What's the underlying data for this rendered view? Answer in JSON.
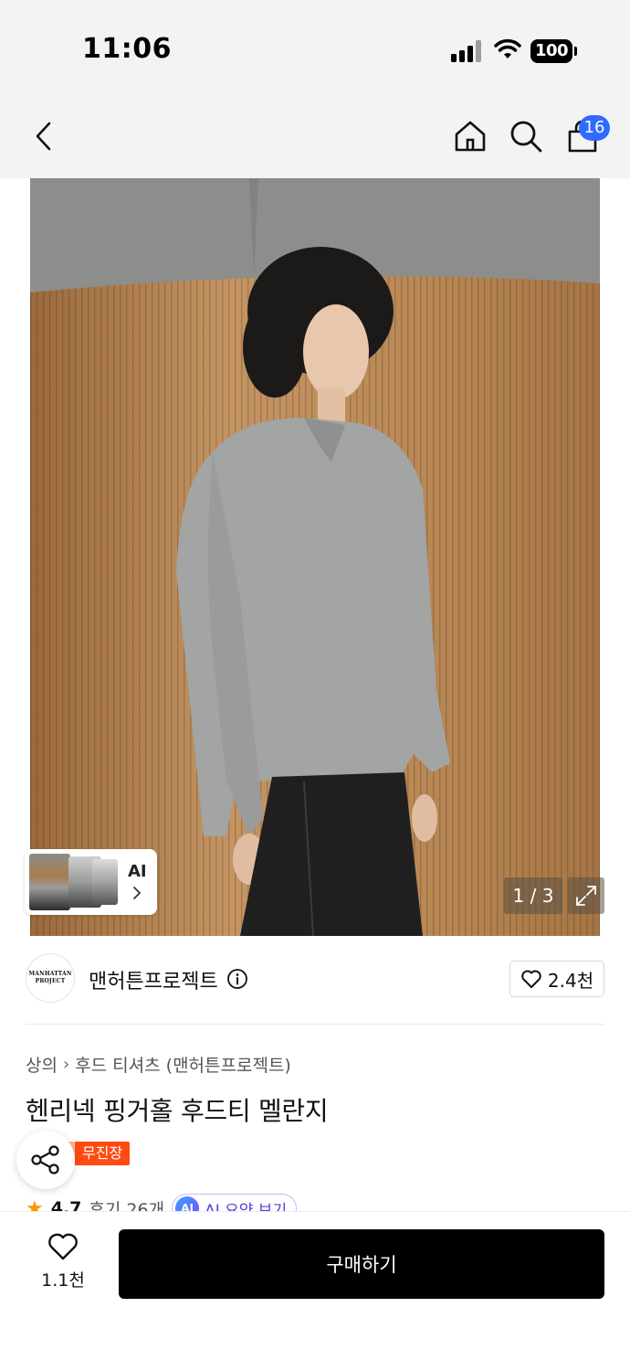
{
  "status_bar": {
    "time": "11:06",
    "battery": "100"
  },
  "nav": {
    "back_icon": "chevron-left-icon",
    "home_icon": "home-icon",
    "search_icon": "search-icon",
    "cart_icon": "shopping-bag-icon",
    "cart_count": "16"
  },
  "gallery": {
    "ai_label": "AI",
    "counter": "1 / 3",
    "expand_icon": "expand-arrows-icon"
  },
  "brand": {
    "logo_line1": "MANHATTAN",
    "logo_line2": "PROJECT",
    "name": "맨허튼프로젝트",
    "likes": "2.4천"
  },
  "product": {
    "breadcrumb": [
      "상의",
      "후드 티셔츠 (맨허튼프로젝트)"
    ],
    "title": "헨리넥 핑거홀 후드티 멜란지",
    "badge": "무진장"
  },
  "rating": {
    "score": "4.7",
    "reviews": "후기 26개",
    "ai_summary_icon": "AI",
    "ai_summary": "AI 요약 보기"
  },
  "bottom": {
    "wish_count": "1.1천",
    "buy_label": "구매하기"
  },
  "colors": {
    "accent_blue": "#2f6bff",
    "badge_orange": "#ff4b12",
    "buy_button": "#000000"
  }
}
